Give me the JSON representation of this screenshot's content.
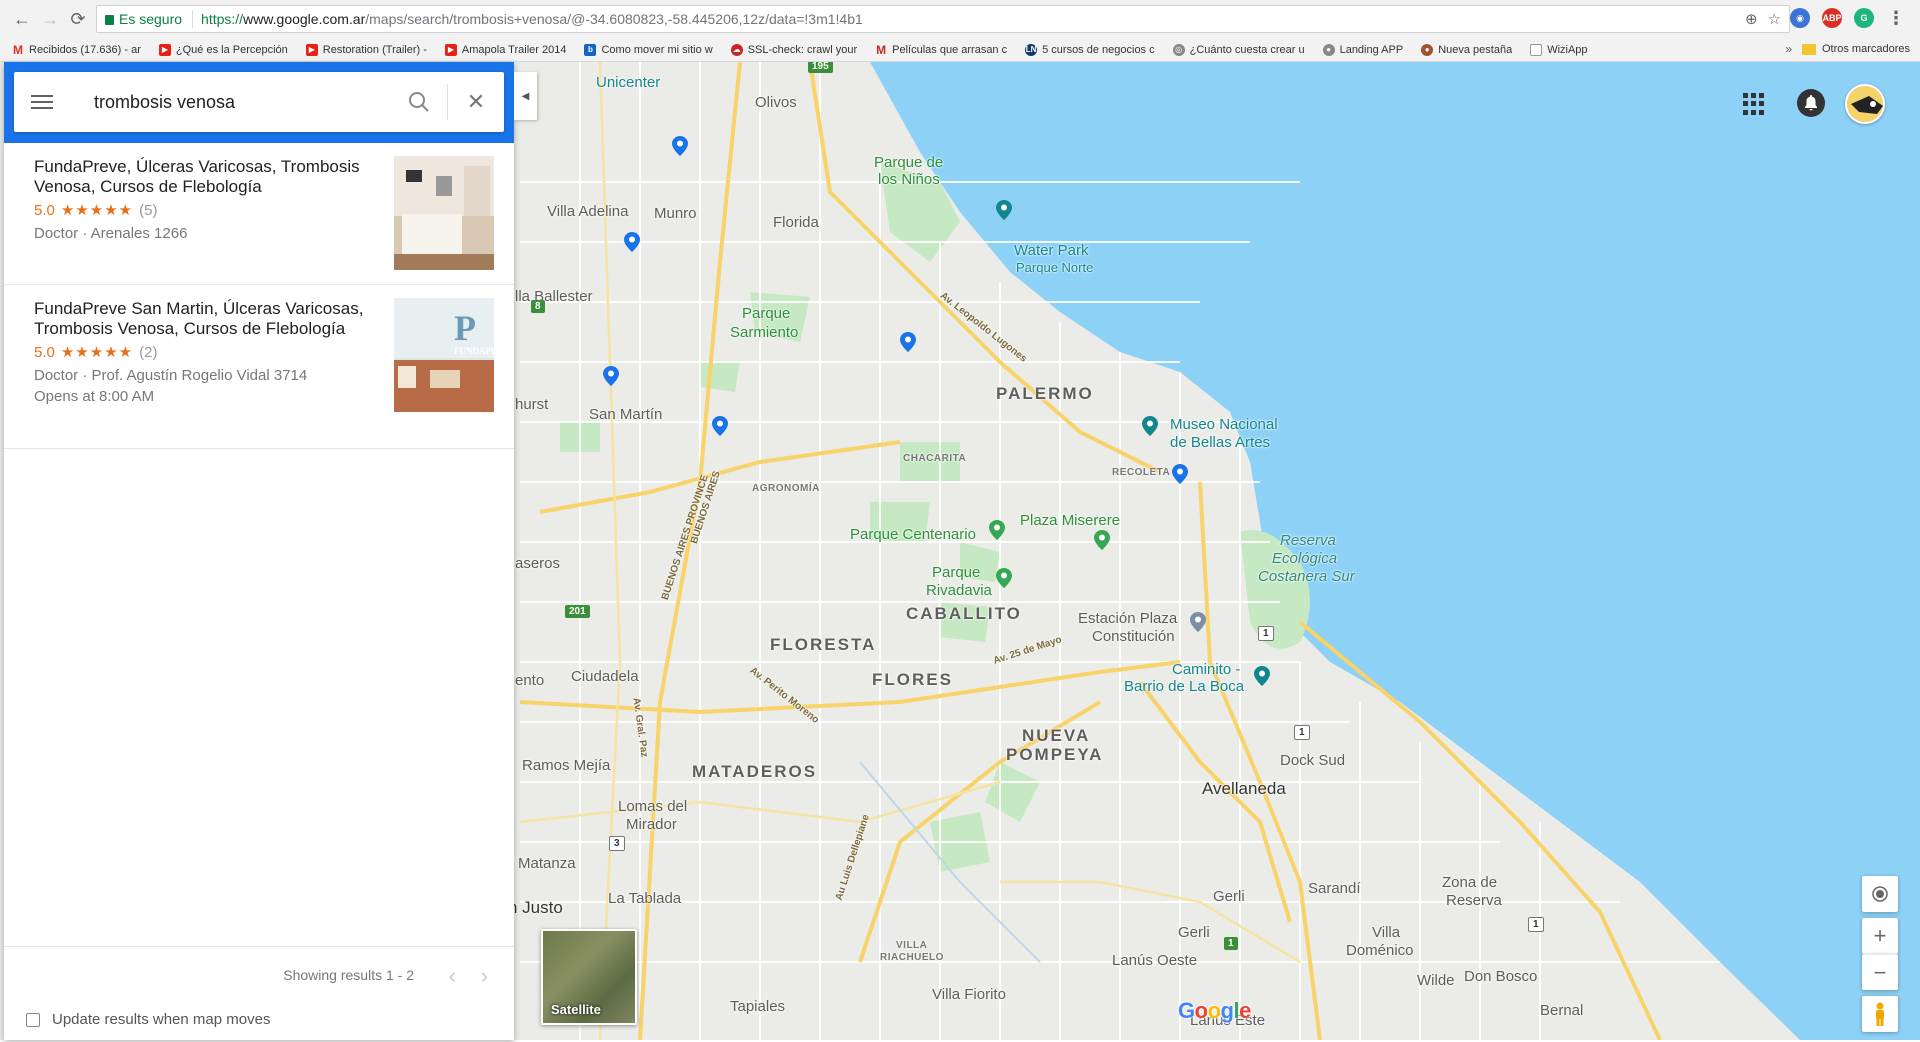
{
  "browser": {
    "secure_label": "Es seguro",
    "url_scheme": "https://",
    "url_host": "www.google.com.ar",
    "url_path": "/maps/search/trombosis+venosa/@-34.6080823,-58.445206,12z/data=!3m1!4b1",
    "bookmarks": [
      {
        "label": "Recibidos (17.636) - ar",
        "icon": "gmail-icon",
        "color": "#d93025"
      },
      {
        "label": "¿Qué es la Percepción",
        "icon": "youtube-icon",
        "color": "#e62117"
      },
      {
        "label": "Restoration (Trailer) -",
        "icon": "youtube-icon",
        "color": "#e62117"
      },
      {
        "label": "Amapola Trailer 2014",
        "icon": "youtube-icon",
        "color": "#e62117"
      },
      {
        "label": "Como mover mi sitio w",
        "icon": "blog-icon",
        "color": "#1565c0"
      },
      {
        "label": "SSL-check: crawl your",
        "icon": "cloud-icon",
        "color": "#c62828"
      },
      {
        "label": "Películas que arrasan c",
        "icon": "m-icon",
        "color": "#c62828"
      },
      {
        "label": "5 cursos de negocios c",
        "icon": "ln-icon",
        "color": "#0d3b66"
      },
      {
        "label": "¿Cuánto cuesta crear u",
        "icon": "globe-icon",
        "color": "#777777"
      },
      {
        "label": "Landing APP",
        "icon": "person-icon",
        "color": "#777777"
      },
      {
        "label": "Nueva pestaña",
        "icon": "avatar-icon",
        "color": "#a0522d"
      },
      {
        "label": "WiziApp",
        "icon": "page-icon",
        "color": "#999999"
      }
    ],
    "more_bookmarks": "»",
    "other_bookmarks": "Otros marcadores"
  },
  "search": {
    "query": "trombosis venosa"
  },
  "results": [
    {
      "name": "FundaPreve, Úlceras Varicosas, Trombosis Venosa, Cursos de Flebología",
      "rating": "5.0",
      "stars": "★★★★★",
      "reviews": "(5)",
      "meta": "Doctor · Arenales 1266",
      "hours": ""
    },
    {
      "name": "FundaPreve San Martin, Úlceras Varicosas, Trombosis Venosa, Cursos de Flebología",
      "rating": "5.0",
      "stars": "★★★★★",
      "reviews": "(2)",
      "meta": "Doctor · Prof. Agustín Rogelio Vidal 3714",
      "hours": "Opens at 8:00 AM"
    }
  ],
  "thumb2_label": "FUNDAPREV",
  "pager": {
    "showing": "Showing results 1 - 2",
    "prev": "‹",
    "next": "›",
    "update_label": "Update results when map moves"
  },
  "map": {
    "satellite_label": "Satellite",
    "google_letters": [
      "G",
      "o",
      "o",
      "g",
      "l",
      "e"
    ],
    "labels": {
      "unicenter": "Unicenter",
      "olivos": "Olivos",
      "parque_ninos_1": "Parque de",
      "parque_ninos_2": "los Niños",
      "villa_adelina": "Villa Adelina",
      "munro": "Munro",
      "florida": "Florida",
      "water_park": "Water Park",
      "parque_norte": "Parque Norte",
      "lugones": "Av. Leopoldo Lugones",
      "villa_ballester": "lla Ballester",
      "parque_sarmiento_1": "Parque",
      "parque_sarmiento_2": "Sarmiento",
      "palermo": "PALERMO",
      "hurst": "hurst",
      "san_martin": "San Martín",
      "museo_1": "Museo Nacional",
      "museo_2": "de Bellas Artes",
      "chacarita": "CHACARITA",
      "recoleta": "RECOLETA",
      "agronomia": "AGRONOMÍA",
      "bap1": "BUENOS AIRES PROVINCE",
      "bap2": "BUENOS AIRES",
      "parque_centenario": "Parque Centenario",
      "plaza_miserere": "Plaza Miserere",
      "reserva_1": "Reserva",
      "reserva_2": "Ecológica",
      "reserva_3": "Costanera Sur",
      "caseros": "aseros",
      "parque_rivadavia_1": "Parque",
      "parque_rivadavia_2": "Rivadavia",
      "caballito": "CABALLITO",
      "estacion_1": "Estación Plaza",
      "estacion_2": "Constitución",
      "floresta": "FLORESTA",
      "av25": "Av. 25 de Mayo",
      "caminito_1": "Caminito -",
      "caminito_2": "Barrio de La Boca",
      "ento": "ento",
      "ciudadela": "Ciudadela",
      "perito": "Av. Perito Moreno",
      "flores": "FLORES",
      "gralpaz": "Av. Gral. Paz",
      "nueva_pompeya_1": "NUEVA",
      "nueva_pompeya_2": "POMPEYA",
      "dock_sud": "Dock Sud",
      "ramos_mejia": "Ramos Mejía",
      "mataderos": "MATADEROS",
      "avellaneda": "Avellaneda",
      "lomas_1": "Lomas del",
      "lomas_2": "Mirador",
      "delepiane": "Au Luis Dellepiane",
      "matanza": "Matanza",
      "sarandi": "Sarandí",
      "zona_reserva_1": "Zona de",
      "zona_reserva_2": "Reserva",
      "gerli_1": "Gerli",
      "la_tablada": "La Tablada",
      "gerli_2": "Gerli",
      "justo": "n Justo",
      "villa_dominico_1": "Villa",
      "villa_dominico_2": "Doménico",
      "villa_riachuelo_1": "VILLA",
      "villa_riachuelo_2": "RIACHUELO",
      "lanus_oeste": "Lanús Oeste",
      "wilde": "Wilde",
      "don_bosco": "Don Bosco",
      "villa_fiorito": "Villa Fiorito",
      "tapiales": "Tapiales",
      "lanus_este": "Lanús Este",
      "bernal": "Bernal"
    },
    "shields": {
      "s195": "195",
      "s8": "8",
      "s201": "201",
      "s1a": "1",
      "s1b": "1",
      "s3": "3",
      "s1c": "1",
      "s1d": "1"
    }
  },
  "colors": {
    "accent": "#1a73e8",
    "water": "#8ed1f7",
    "park": "#c6e8c3",
    "star": "#e7711b",
    "pin": "#1a73e8"
  }
}
